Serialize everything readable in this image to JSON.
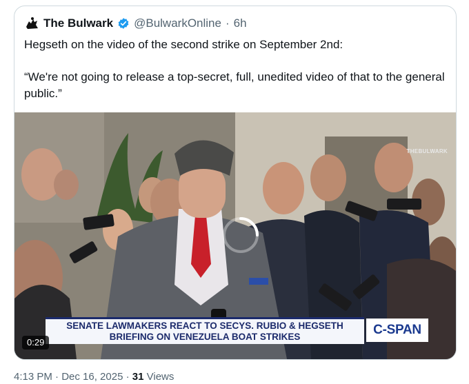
{
  "tweet": {
    "account_name": "The Bulwark",
    "handle": "@BulwarkOnline",
    "separator": "·",
    "relative_time": "6h",
    "text_line1": "Hegseth on the video of the second strike on September 2nd:",
    "text_line2": "“We're not going to release a top-secret, full, unedited video of that to the general public.”"
  },
  "video": {
    "watermark": "THEBULWARK",
    "chyron_line1": "SENATE LAWMAKERS REACT TO SECYS. RUBIO & HEGSETH",
    "chyron_line2": "BRIEFING ON VENEZUELA BOAT STRIKES",
    "network_logo": "C-SPAN",
    "duration": "0:29"
  },
  "footer": {
    "timestamp": "4:13 PM · Dec 16, 2025 ·",
    "views_count": "31",
    "views_label": "Views"
  },
  "colors": {
    "verified_badge": "#1d9bf0",
    "secondary_text": "#536471",
    "chyron_text": "#1b2a6b",
    "cspan_blue": "#1b3a8f"
  },
  "icons": {
    "logo": "bulwark-logo-icon",
    "verified": "verified-badge-icon",
    "loading": "loading-spinner-icon"
  }
}
